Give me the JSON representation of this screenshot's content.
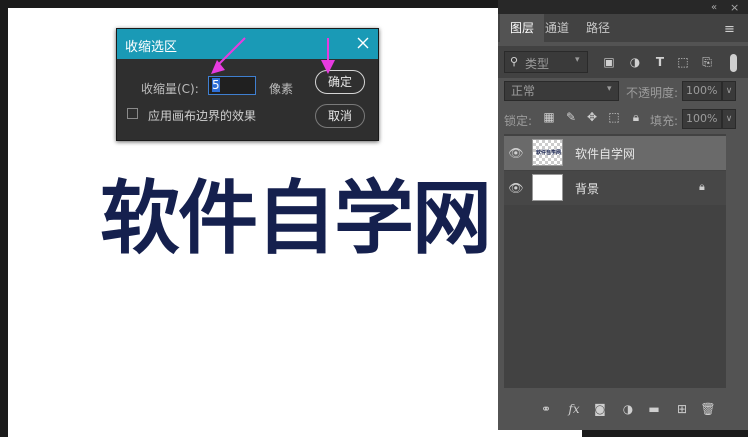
{
  "dialog": {
    "title": "收缩选区",
    "contract_label": "收缩量(C):",
    "contract_value": "5",
    "unit": "像素",
    "ok_label": "确定",
    "cancel_label": "取消",
    "apply_canvas_edges_label": "应用画布边界的效果",
    "apply_canvas_edges_checked": false,
    "close_icon": "close-icon",
    "accent_color": "#1a9ab6"
  },
  "canvas": {
    "text": "软件自学网",
    "text_color": "#15204e"
  },
  "annotations": {
    "arrow_color": "#e73be0"
  },
  "panel": {
    "tabs": [
      {
        "label": "图层",
        "active": true
      },
      {
        "label": "通道",
        "active": false
      },
      {
        "label": "路径",
        "active": false
      }
    ],
    "filter": {
      "label": "类型",
      "icon": "search-icon"
    },
    "blend_mode": "正常",
    "opacity_label": "不透明度:",
    "opacity_value": "100%",
    "lock_label": "锁定:",
    "fill_label": "填充:",
    "fill_value": "100%",
    "layers": [
      {
        "name": "软件自学网",
        "selected": true,
        "thumbnail_text": "软件自学网"
      },
      {
        "name": "背景",
        "selected": false,
        "locked": true
      }
    ]
  }
}
